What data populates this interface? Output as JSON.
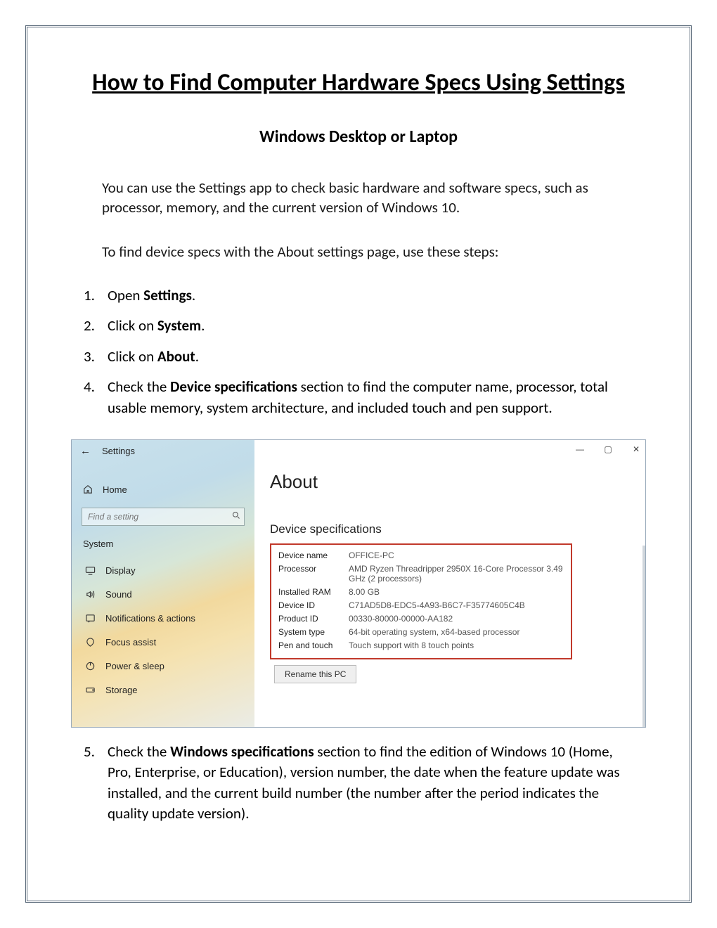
{
  "doc": {
    "title": "How to Find Computer Hardware Specs Using Settings",
    "subtitle": "Windows Desktop or Laptop",
    "intro1": "You can use the Settings app to check basic hardware and software specs, such as processor, memory, and the current version of Windows 10.",
    "intro2": "To find device specs with the About settings page, use these steps:",
    "steps": {
      "s1": {
        "num": "1.",
        "pre": "Open ",
        "bold": "Settings",
        "post": "."
      },
      "s2": {
        "num": "2.",
        "pre": "Click on ",
        "bold": "System",
        "post": "."
      },
      "s3": {
        "num": "3.",
        "pre": "Click on ",
        "bold": "About",
        "post": "."
      },
      "s4": {
        "num": "4.",
        "pre": "Check the ",
        "bold": "Device specifications",
        "post": " section to find the computer name, processor, total usable memory, system architecture, and included touch and pen support."
      },
      "s5": {
        "num": "5.",
        "pre": "Check the ",
        "bold": "Windows specifications",
        "post": " section to find the edition of Windows 10 (Home, Pro, Enterprise, or Education), version number, the date when the feature update was installed, and the current build number (the number after the period indicates the quality update version)."
      }
    }
  },
  "win": {
    "title": "Settings",
    "home": "Home",
    "search_placeholder": "Find a setting",
    "section": "System",
    "sidebar": {
      "display": "Display",
      "sound": "Sound",
      "notifications": "Notifications & actions",
      "focus": "Focus assist",
      "power": "Power & sleep",
      "storage": "Storage"
    },
    "about_heading": "About",
    "spec_heading": "Device specifications",
    "specs": {
      "device_name": {
        "label": "Device name",
        "val": "OFFICE-PC"
      },
      "processor": {
        "label": "Processor",
        "val": "AMD Ryzen Threadripper 2950X 16-Core Processor 3.49 GHz  (2 processors)"
      },
      "ram": {
        "label": "Installed RAM",
        "val": "8.00 GB"
      },
      "deviceid": {
        "label": "Device ID",
        "val": "C71AD5D8-EDC5-4A93-B6C7-F35774605C4B"
      },
      "productid": {
        "label": "Product ID",
        "val": "00330-80000-00000-AA182"
      },
      "systype": {
        "label": "System type",
        "val": "64-bit operating system, x64-based processor"
      },
      "pentouch": {
        "label": "Pen and touch",
        "val": "Touch support with 8 touch points"
      }
    },
    "rename": "Rename this PC",
    "controls": {
      "min": "—",
      "max": "▢",
      "close": "✕"
    }
  }
}
